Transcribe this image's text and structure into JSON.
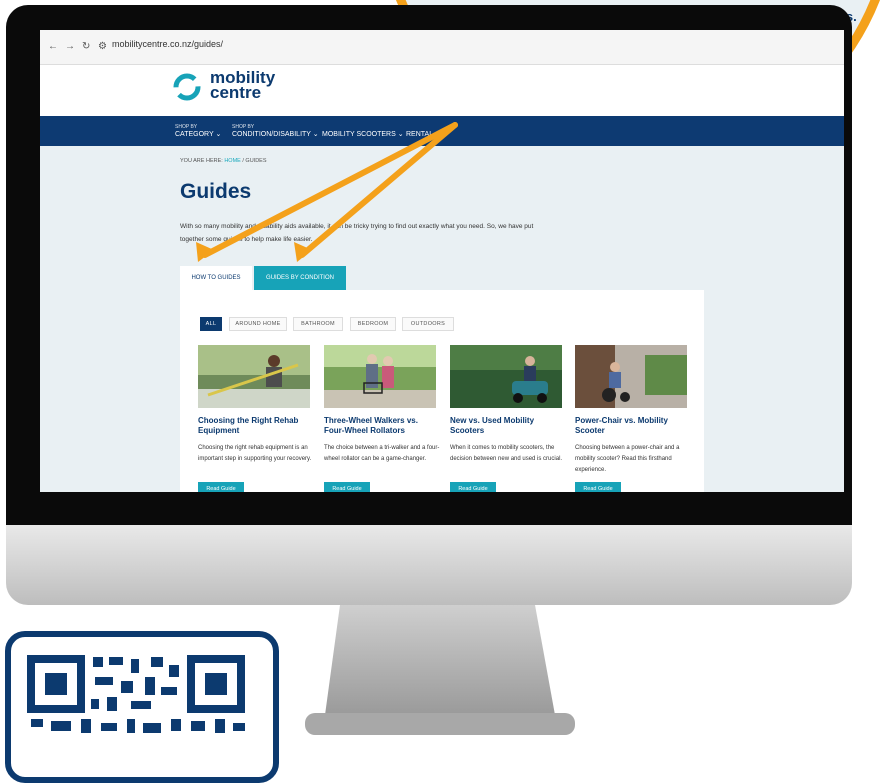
{
  "browser": {
    "url": "mobilitycentre.co.nz/guides/"
  },
  "logo": {
    "line1": "mobility",
    "line2": "centre"
  },
  "nav": [
    {
      "small": "SHOP BY",
      "label": "CATEGORY ⌄"
    },
    {
      "small": "SHOP BY",
      "label": "CONDITION/DISABILITY ⌄"
    },
    {
      "small": "",
      "label": "MOBILITY SCOOTERS ⌄"
    },
    {
      "small": "",
      "label": "RENTAL"
    }
  ],
  "breadcrumb": {
    "prefix": "YOU ARE HERE: ",
    "home": "HOME",
    "current": " / GUIDES"
  },
  "page": {
    "title": "Guides",
    "intro": "With so many mobility and disability aids available, it can be tricky trying to find out exactly what you need. So, we have put together some guides to help make life easier."
  },
  "tabs": [
    {
      "label": "HOW TO GUIDES"
    },
    {
      "label": "GUIDES BY CONDITION"
    }
  ],
  "filters": [
    {
      "label": "ALL"
    },
    {
      "label": "AROUND HOME"
    },
    {
      "label": "BATHROOM"
    },
    {
      "label": "BEDROOM"
    },
    {
      "label": "OUTDOORS"
    }
  ],
  "cards": [
    {
      "title": "Choosing the Right Rehab Equipment",
      "desc": "Choosing the right rehab equipment is an important step in supporting your recovery.",
      "btn": "Read Guide"
    },
    {
      "title": "Three-Wheel Walkers vs. Four-Wheel Rollators",
      "desc": "The choice between a tri-walker and a four-wheel rollator can be a game-changer.",
      "btn": "Read Guide"
    },
    {
      "title": "New vs. Used Mobility Scooters",
      "desc": "When it comes to mobility scooters, the decision between new and used is crucial.",
      "btn": "Read Guide"
    },
    {
      "title": "Power-Chair vs. Mobility Scooter",
      "desc": "Choosing between a power-chair and a mobility scooter? Read this firsthand experience.",
      "btn": "Read Guide"
    }
  ],
  "colors": {
    "brand": "#0c3a6f",
    "accent": "#17a3b8",
    "callout": "#f4a11b"
  }
}
